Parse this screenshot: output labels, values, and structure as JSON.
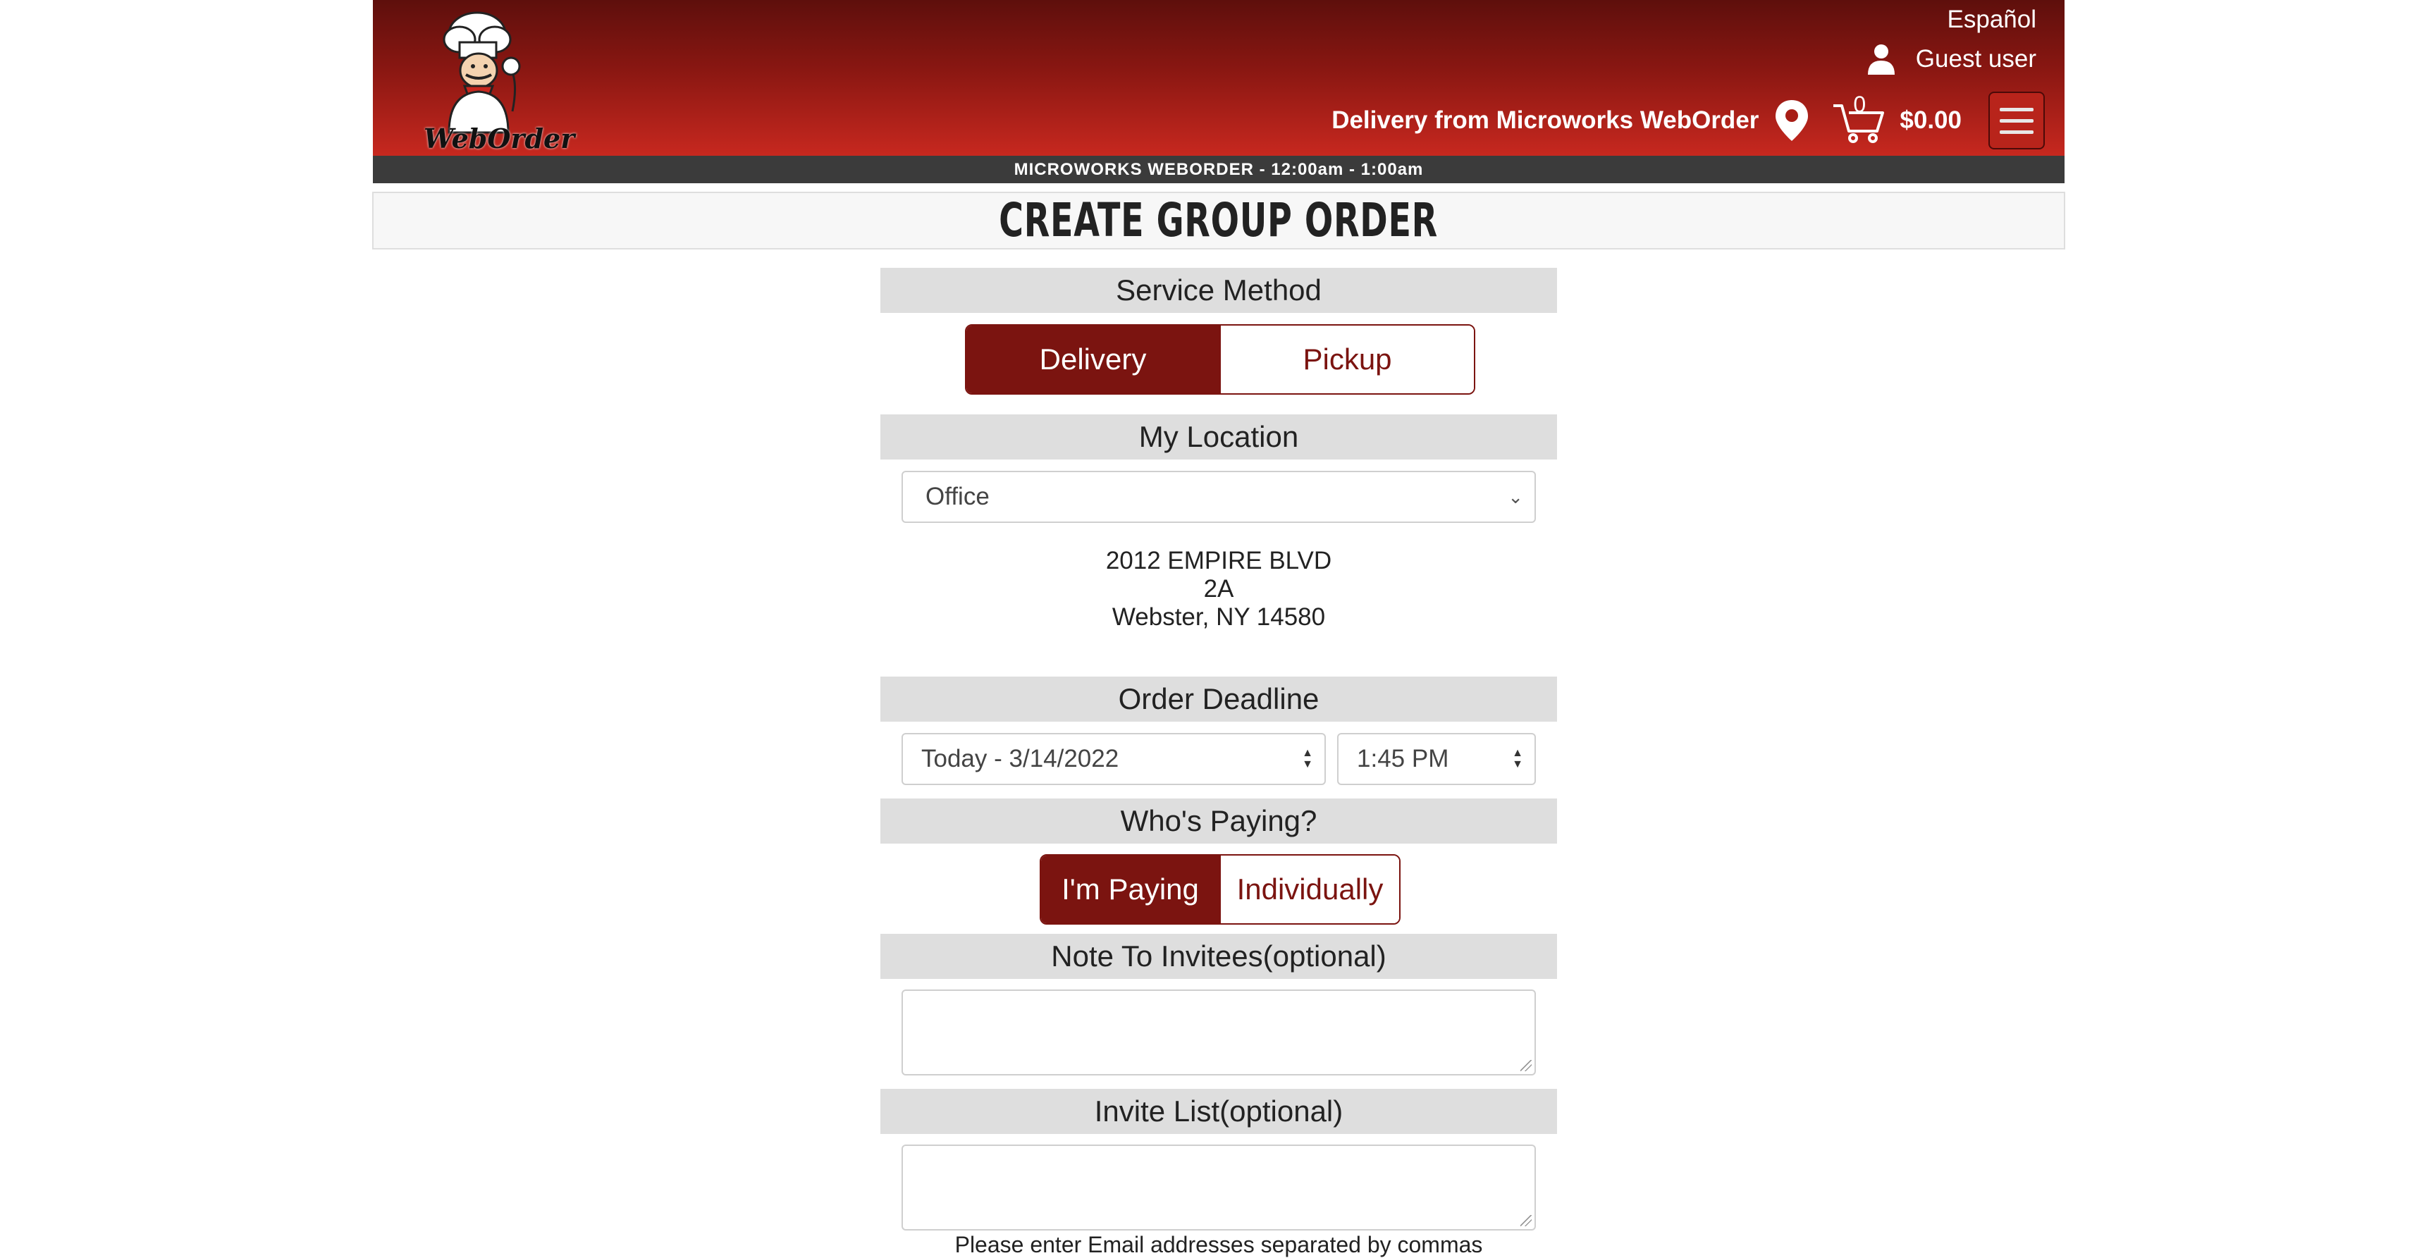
{
  "header": {
    "logo_text": "WebOrder",
    "language_link": "Español",
    "user_label": "Guest user",
    "delivery_text": "Delivery from Microworks WebOrder",
    "cart_count": "0",
    "cart_total": "$0.00",
    "hours_bar": "MICROWORKS WEBORDER - 12:00am - 1:00am"
  },
  "page_title": "Create Group Order",
  "service_method": {
    "heading": "Service Method",
    "options": [
      "Delivery",
      "Pickup"
    ],
    "selected": "Delivery"
  },
  "location": {
    "heading": "My Location",
    "selected": "Office",
    "address_line1": "2012 EMPIRE BLVD",
    "address_line2": "2A",
    "address_line3": "Webster, NY 14580"
  },
  "deadline": {
    "heading": "Order Deadline",
    "date_value": "Today - 3/14/2022",
    "time_value": "1:45 PM"
  },
  "paying": {
    "heading": "Who's Paying?",
    "options": [
      "I'm Paying",
      "Individually"
    ],
    "selected": "I'm Paying"
  },
  "note": {
    "heading": "Note To Invitees(optional)",
    "value": ""
  },
  "invite": {
    "heading": "Invite List(optional)",
    "value": "",
    "hint": "Please enter Email addresses separated by commas"
  },
  "colors": {
    "brand_dark": "#7b1410",
    "header_top": "#5e0f0c",
    "header_bottom": "#c7281f",
    "hours_bar": "#3b3b3b",
    "section_bg": "#dedede"
  }
}
